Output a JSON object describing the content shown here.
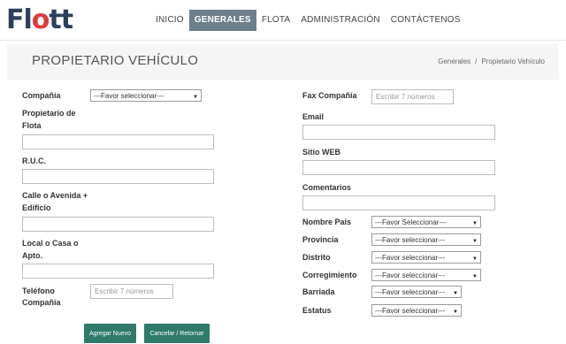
{
  "brand": {
    "logo_text_1": "Fl",
    "logo_text_2": "o",
    "logo_text_3": "tt"
  },
  "nav": {
    "items": [
      {
        "label": "INICIO"
      },
      {
        "label": "GENERALES"
      },
      {
        "label": "FLOTA"
      },
      {
        "label": "ADMINISTRACIÓN"
      },
      {
        "label": "CONTÁCTENOS"
      }
    ]
  },
  "page": {
    "title": "PROPIETARIO VEHÍCULO",
    "breadcrumb": {
      "parent": "Generales",
      "separator": "/",
      "current": "Propietario Vehículo"
    }
  },
  "form": {
    "left": {
      "compania_label": "Compañía",
      "compania_select": "---Favor seleccionar---",
      "propietario_label_1": "Propietario de",
      "propietario_label_2": "Flota",
      "ruc_label": "R.U.C.",
      "calle_label_1": "Calle o Avenida +",
      "calle_label_2": "Edificio",
      "local_label_1": "Local o Casa o",
      "local_label_2": "Apto.",
      "telefono_label_1": "Teléfono",
      "telefono_label_2": "Compañía",
      "telefono_placeholder": "Escribir 7 números"
    },
    "right": {
      "fax_label": "Fax Compañía",
      "fax_placeholder": "Escribir 7 números",
      "email_label": "Email",
      "web_label": "Sitio WEB",
      "comentarios_label": "Comentarios",
      "pais_label": "Nombre País",
      "pais_select": "---Favor Seleccionar---",
      "provincia_label": "Provincia",
      "provincia_select": "---Favor seleccionar---",
      "distrito_label": "Distrito",
      "distrito_select": "---Favor seleccionar---",
      "corregimiento_label": "Corregimiento",
      "corregimiento_select": "---Favor seleccionar---",
      "barriada_label": "Barriada",
      "barriada_select": "---Favor seleccionar---",
      "estatus_label": "Estatus",
      "estatus_select": "---Favor seleccionar---"
    },
    "buttons": {
      "add": "Agregar Nuevo",
      "cancel": "Cancelar / Retornar"
    }
  }
}
